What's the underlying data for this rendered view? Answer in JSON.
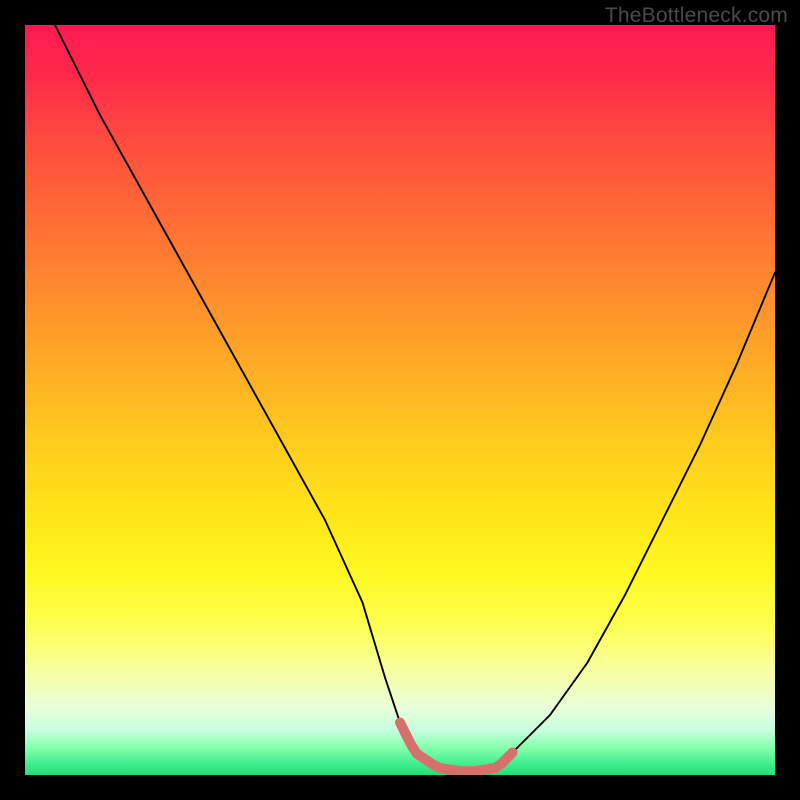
{
  "watermark": "TheBottleneck.com",
  "chart_data": {
    "type": "line",
    "title": "",
    "xlabel": "",
    "ylabel": "",
    "xlim": [
      0,
      100
    ],
    "ylim": [
      0,
      100
    ],
    "grid": false,
    "legend": false,
    "series": [
      {
        "name": "bottleneck-curve",
        "x": [
          4,
          10,
          15,
          20,
          25,
          30,
          35,
          40,
          45,
          48,
          50,
          52,
          55,
          58,
          60,
          63,
          65,
          70,
          75,
          80,
          85,
          90,
          95,
          100
        ],
        "y": [
          100,
          88,
          79,
          70,
          61,
          52,
          43,
          34,
          23,
          13,
          7,
          3,
          1,
          0.5,
          0.5,
          1,
          3,
          8,
          15,
          24,
          34,
          44,
          55,
          67
        ]
      }
    ],
    "highlight_region": {
      "name": "sweet-spot",
      "x": [
        50,
        65
      ],
      "y_approx": 1.5,
      "color": "#d6706c"
    },
    "background_gradient": {
      "top": "#ff1a52",
      "mid": "#ffe418",
      "bottom": "#20df78"
    }
  }
}
